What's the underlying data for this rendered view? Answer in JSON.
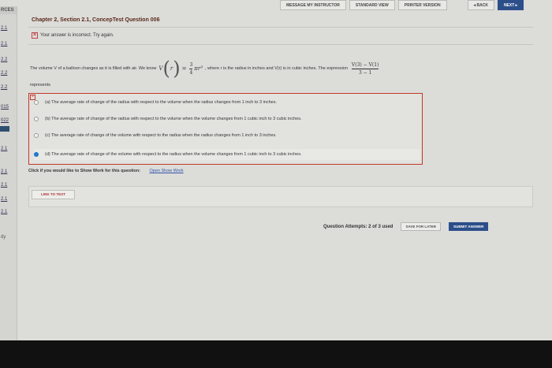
{
  "nav": {
    "message_instructor": "MESSAGE MY INSTRUCTOR",
    "standard_view": "STANDARD VIEW",
    "printer_version": "PRINTER VERSION",
    "back": "◂ BACK",
    "next": "NEXT ▸"
  },
  "sidebar": {
    "header": "RCES",
    "items": [
      "2.1",
      "2.1",
      "2.2",
      "2.2",
      "2.2",
      "015",
      "022",
      "2.1",
      "2.1",
      "2.1",
      "2.1",
      "2.1"
    ],
    "bottom": "dy"
  },
  "question": {
    "title": "Chapter 2, Section 2.1, ConcepTest Question 006",
    "feedback": "Your answer is incorrect.  Try again.",
    "text_part1": "The volume V of a balloon changes as it is filled with air. We know",
    "formula_lhs_fn": "V",
    "formula_lhs_arg": "r",
    "formula_eq": "=",
    "formula_num": "3",
    "formula_den": "4",
    "formula_rest": "πr³",
    "text_part2": ", where r is the radius in inches and V(r) is in cubic inches. The expression",
    "expr_num": "V(3) − V(1)",
    "expr_den": "3 − 1",
    "represents": "represents"
  },
  "choices": [
    {
      "label": "(a) The average rate of change of the radius with respect to the volume when the radius changes from 1 inch to 3 inches.",
      "selected": false
    },
    {
      "label": "(b) The average rate of change of the radius with respect to the volume when the volume changes from 1 cubic inch to 3 cubic inches.",
      "selected": false
    },
    {
      "label": "(c) The average rate of change of the volume with respect to the radius when the radius changes from 1 inch to 3 inches.",
      "selected": false
    },
    {
      "label": "(d) The average rate of change of the volume with respect to the radius when the volume changes from 1 cubic inch to 3 cubic inches.",
      "selected": true
    }
  ],
  "show_work": {
    "prompt": "Click if you would like to Show Work for this question:",
    "link": "Open Show Work"
  },
  "link_to_text": "LINK TO TEXT",
  "footer": {
    "attempts": "Question Attempts: 2 of 3 used",
    "save_later": "SAVE FOR LATER",
    "submit": "SUBMIT ANSWER"
  }
}
